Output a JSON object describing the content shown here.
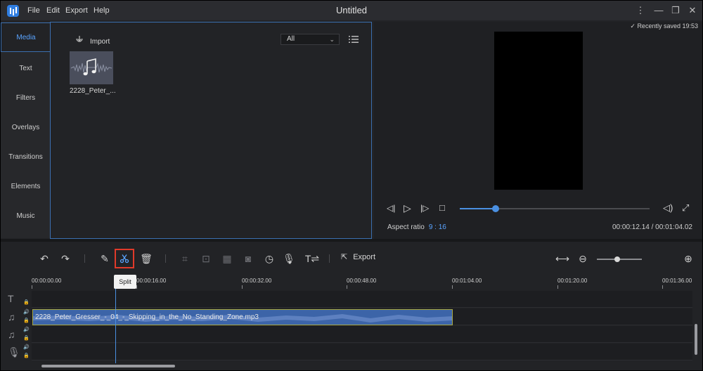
{
  "titlebar": {
    "title": "Untitled",
    "menu": [
      "File",
      "Edit",
      "Export",
      "Help"
    ]
  },
  "sidebar": {
    "items": [
      {
        "label": "Media",
        "active": true
      },
      {
        "label": "Text",
        "active": false
      },
      {
        "label": "Filters",
        "active": false
      },
      {
        "label": "Overlays",
        "active": false
      },
      {
        "label": "Transitions",
        "active": false
      },
      {
        "label": "Elements",
        "active": false
      },
      {
        "label": "Music",
        "active": false
      }
    ]
  },
  "media": {
    "import_label": "Import",
    "filter_value": "All",
    "items": [
      {
        "name": "2228_Peter_...",
        "icon": "music-note-icon"
      }
    ]
  },
  "preview": {
    "saved_label": "Recently saved 19:53",
    "aspect_label": "Aspect ratio",
    "aspect_value": "9 : 16",
    "timecode": "00:00:12.14 / 00:01:04.02",
    "progress": 0.19
  },
  "toolbar": {
    "export_label": "Export",
    "tooltip": "Split",
    "zoom_level": 0.45
  },
  "timeline": {
    "ruler": [
      "00:00:00.00",
      "00:00:16.00",
      "00:00:32.00",
      "00:00:48.00",
      "00:01:04.00",
      "00:01:20.00",
      "00:01:36.00"
    ],
    "clip_name": "2228_Peter_Gresser_-_04_-_Skipping_in_the_No_Standing_Zone.mp3"
  },
  "colors": {
    "accent": "#4a90e2",
    "highlight": "#e03a2a",
    "clip": "#3c64a8"
  }
}
